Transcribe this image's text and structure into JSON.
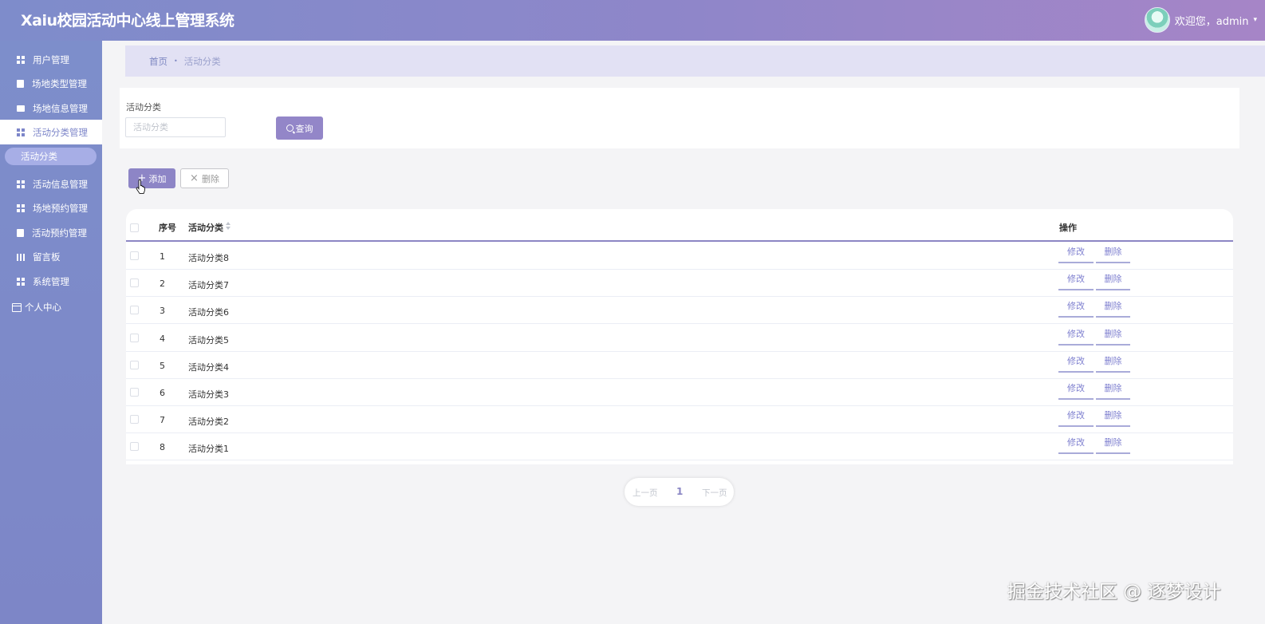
{
  "app": {
    "title": "Xaiu校园活动中心线上管理系统"
  },
  "user": {
    "welcome": "欢迎您，admin",
    "caret": "▾"
  },
  "sidebar": {
    "items": [
      {
        "label": "用户管理",
        "icon": "grid-icon"
      },
      {
        "label": "场地类型管理",
        "icon": "clipboard-icon"
      },
      {
        "label": "场地信息管理",
        "icon": "chat-icon"
      },
      {
        "label": "活动分类管理",
        "icon": "grid-icon",
        "active": true
      },
      {
        "label": "活动信息管理",
        "icon": "grid-icon"
      },
      {
        "label": "场地预约管理",
        "icon": "grid-icon"
      },
      {
        "label": "活动预约管理",
        "icon": "clipboard-icon"
      },
      {
        "label": "留言板",
        "icon": "board-icon"
      },
      {
        "label": "系统管理",
        "icon": "grid-icon"
      }
    ],
    "sub_item": "活动分类",
    "profile": "个人中心"
  },
  "breadcrumb": {
    "home": "首页",
    "separator": "•",
    "current": "活动分类"
  },
  "search": {
    "label": "活动分类",
    "placeholder": "活动分类",
    "value": "",
    "button": "查询"
  },
  "toolbar": {
    "add": "添加",
    "delete": "删除"
  },
  "table": {
    "columns": {
      "index": "序号",
      "category": "活动分类",
      "actions": "操作"
    },
    "rows": [
      {
        "index": "1",
        "category": "活动分类8"
      },
      {
        "index": "2",
        "category": "活动分类7"
      },
      {
        "index": "3",
        "category": "活动分类6"
      },
      {
        "index": "4",
        "category": "活动分类5"
      },
      {
        "index": "5",
        "category": "活动分类4"
      },
      {
        "index": "6",
        "category": "活动分类3"
      },
      {
        "index": "7",
        "category": "活动分类2"
      },
      {
        "index": "8",
        "category": "活动分类1"
      }
    ],
    "row_actions": {
      "edit": "修改",
      "delete": "删除"
    }
  },
  "pagination": {
    "prev": "上一页",
    "current": "1",
    "next": "下一页"
  },
  "watermark": "掘金技术社区 @ 逐梦设计",
  "colors": {
    "accent": "#8d85c6",
    "sidebar": "#7d8ecb",
    "breadcrumb_bg": "#e2e1f4",
    "link": "#7e7fcf"
  }
}
